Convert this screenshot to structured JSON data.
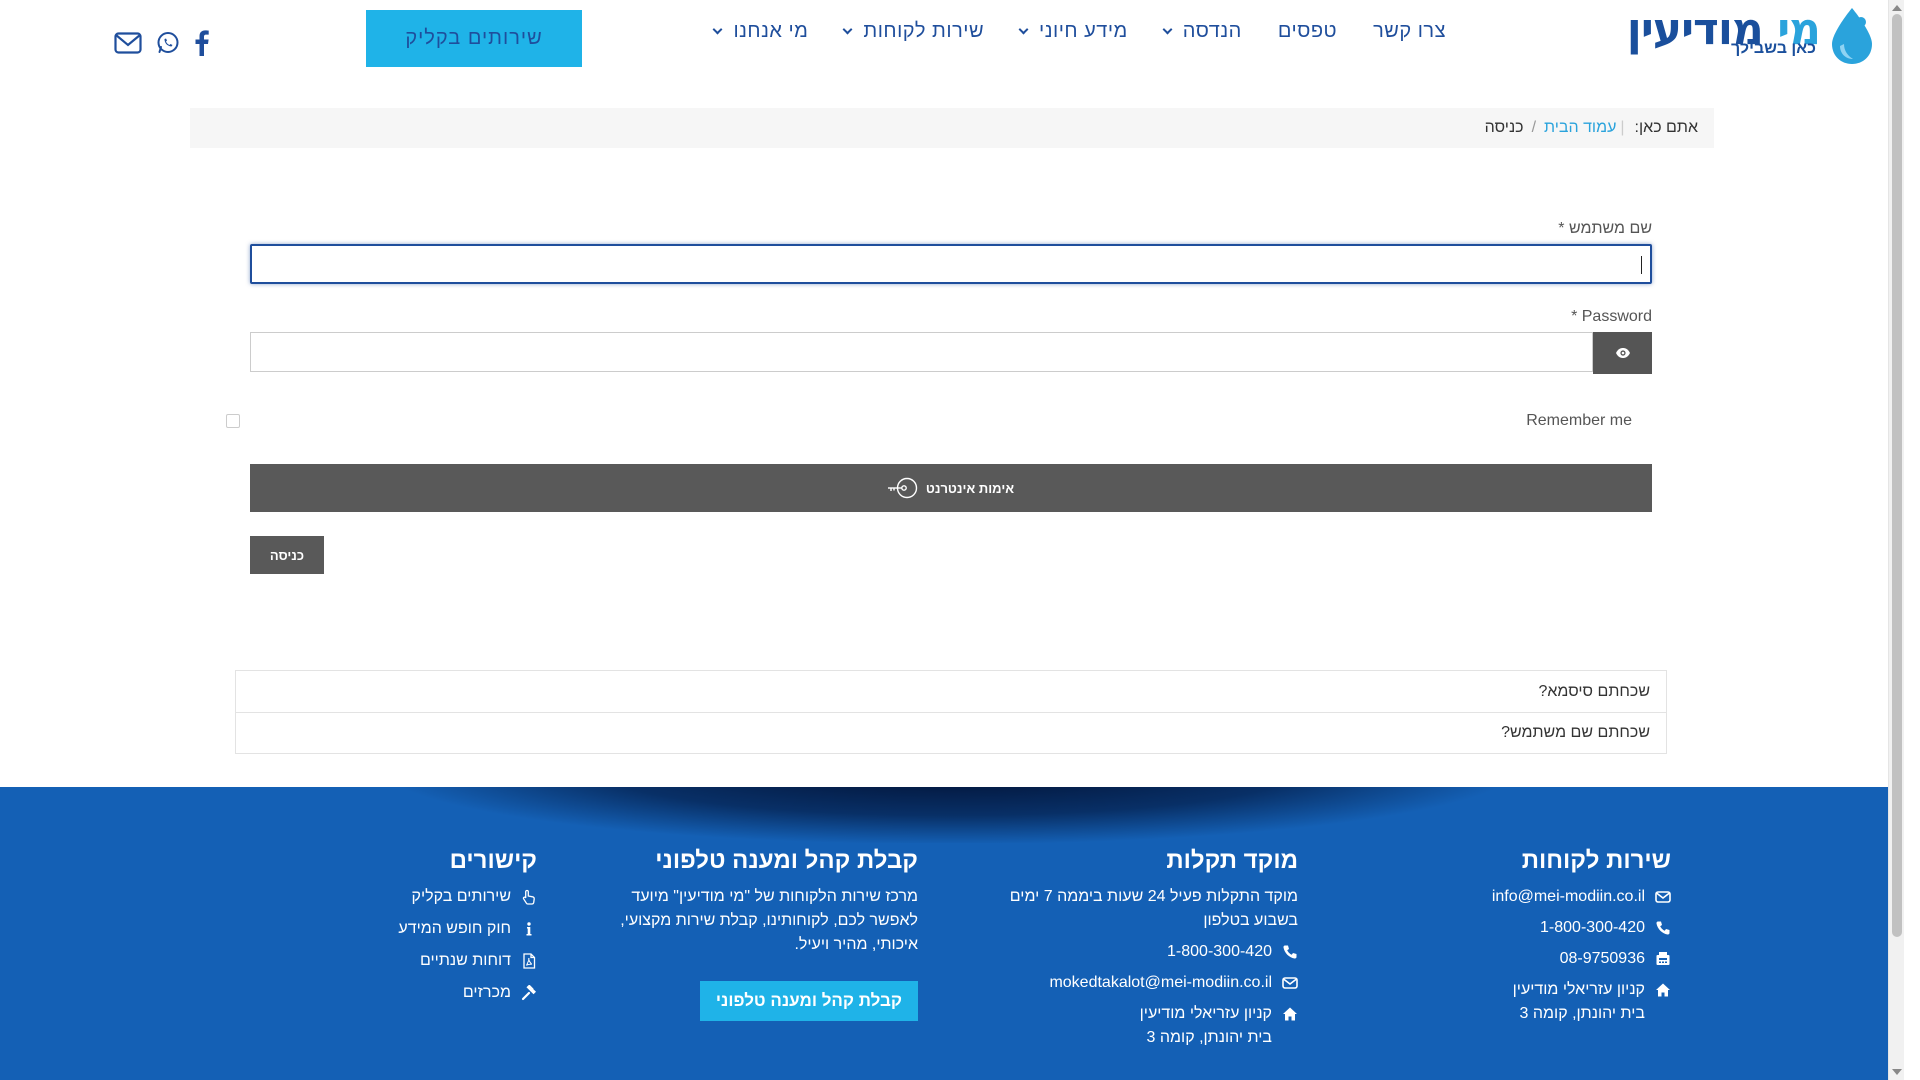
{
  "header": {
    "logo": {
      "name_light": "מי",
      "name_dark": "מודיעין",
      "tagline": "כאן בשבילך"
    },
    "nav": [
      {
        "label": "מי אנחנו",
        "dropdown": true
      },
      {
        "label": "שירות לקוחות",
        "dropdown": true
      },
      {
        "label": "מידע חיוני",
        "dropdown": true
      },
      {
        "label": "הנדסה",
        "dropdown": true
      },
      {
        "label": "טפסים",
        "dropdown": false
      },
      {
        "label": "צרו קשר",
        "dropdown": false
      }
    ],
    "cta_label": "שירותים בקליק",
    "social_icons": [
      "facebook-icon",
      "whatsapp-icon",
      "envelope-icon"
    ]
  },
  "breadcrumb": {
    "prefix": "אתם כאן:",
    "home": "עמוד הבית",
    "separator": "/",
    "current": "כניסה"
  },
  "form": {
    "username_label": "שם משתמש *",
    "username_value": "",
    "password_label": "Password *",
    "password_value": "",
    "remember_label": "Remember me",
    "auth_button": "אימות אינטרנט",
    "login_button": "כניסה"
  },
  "forgot": {
    "password": "שכחתם סיסמא?",
    "username": "שכחתם שם משתמש?"
  },
  "footer": {
    "customer_service": {
      "title": "שירות לקוחות",
      "email": "info@mei-modiin.co.il",
      "phone": "1-800-300-420",
      "fax": "08-9750936",
      "address_line1": "קניון עזריאלי מודיעין",
      "address_line2": "בית יהונתן, קומה 3"
    },
    "fault_center": {
      "title": "מוקד תקלות",
      "description": "מוקד התקלות פעיל 24 שעות ביממה 7 ימים בשבוע בטלפון",
      "phone": "1-800-300-420",
      "email": "mokedtakalot@mei-modiin.co.il",
      "address_line1": "קניון עזריאלי מודיעין",
      "address_line2": "בית יהונתן, קומה 3"
    },
    "reception": {
      "title": "קבלת קהל ומענה טלפוני",
      "description": "מרכז שירות הלקוחות של \"מי מודיעין\" מיועד לאפשר לכם, לקוחותינו, קבלת שירות מקצועי, איכותי, מהיר ויעיל.",
      "button": "קבלת קהל ומענה טלפוני"
    },
    "links": {
      "title": "קישורים",
      "items": [
        {
          "label": "שירותים בקליק",
          "icon": "hand-pointer-icon"
        },
        {
          "label": "חוק חופש המידע",
          "icon": "info-icon"
        },
        {
          "label": "דוחות שנתיים",
          "icon": "pdf-file-icon"
        },
        {
          "label": "מכרזים",
          "icon": "gavel-icon"
        }
      ]
    }
  },
  "colors": {
    "brand_dark": "#1f4e9c",
    "brand_light": "#1fb3e8",
    "footer_bg": "#1460b5",
    "button_gray": "#595959"
  }
}
